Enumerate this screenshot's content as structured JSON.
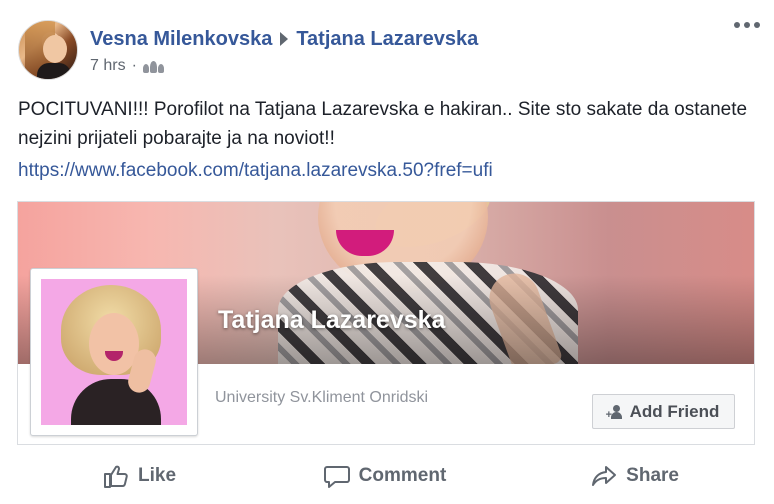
{
  "post": {
    "author": "Vesna Milenkovska",
    "recipient": "Tatjana Lazarevska",
    "time": "7 hrs",
    "separator": "·",
    "audience_icon": "friends-icon",
    "more_icon": "more-options-icon",
    "text": "POCITUVANI!!! Porofilot na Tatjana Lazarevska e hakiran.. Site sto sakate da ostanete nejzini prijateli pobarajte ja na noviot!!",
    "link": "https://www.facebook.com/tatjana.lazarevska.50?fref=ufi"
  },
  "share_card": {
    "profile_name": "Tatjana Lazarevska",
    "university": "University Sv.Kliment Onridski",
    "add_friend_label": "Add Friend",
    "add_friend_icon": "add-friend-icon"
  },
  "actions": {
    "like_label": "Like",
    "comment_label": "Comment",
    "share_label": "Share",
    "like_icon": "thumbs-up-icon",
    "comment_icon": "comment-bubble-icon",
    "share_icon": "share-arrow-icon"
  },
  "colors": {
    "link_blue": "#365899",
    "meta_gray": "#606770",
    "muted_gray": "#90949c",
    "profile_bg_pink": "#f4a8e6"
  }
}
